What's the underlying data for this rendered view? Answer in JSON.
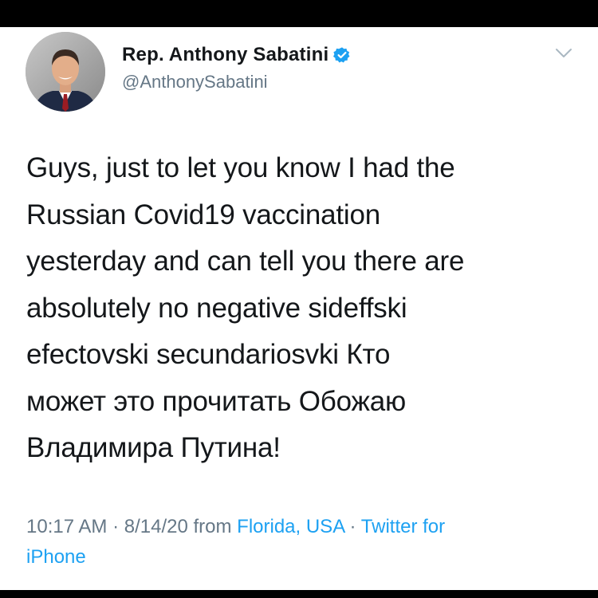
{
  "tweet": {
    "author": {
      "display_name": "Rep. Anthony Sabatini",
      "handle": "@AnthonySabatini",
      "verified": true,
      "avatar_icon": "profile-photo"
    },
    "menu_icon": "chevron-down-icon",
    "text_lines": [
      "Guys, just to let you know I had the",
      "Russian Covid19 vaccination",
      "yesterday and can tell you there are",
      "absolutely no negative sideffski",
      "efectovski secundariosvki Кто",
      "может это прочитать Обожаю",
      "Владимира Путина!"
    ],
    "meta": {
      "time": "10:17 AM",
      "separator": " · ",
      "date": "8/14/20",
      "from_prefix": " from ",
      "location": "Florida, USA",
      "source_line1": "Twitter for",
      "source_line2": "iPhone"
    }
  },
  "colors": {
    "background": "#ffffff",
    "frame": "#000000",
    "text": "#14171a",
    "muted": "#657786",
    "link": "#1da1f2",
    "verified": "#1da1f2"
  }
}
